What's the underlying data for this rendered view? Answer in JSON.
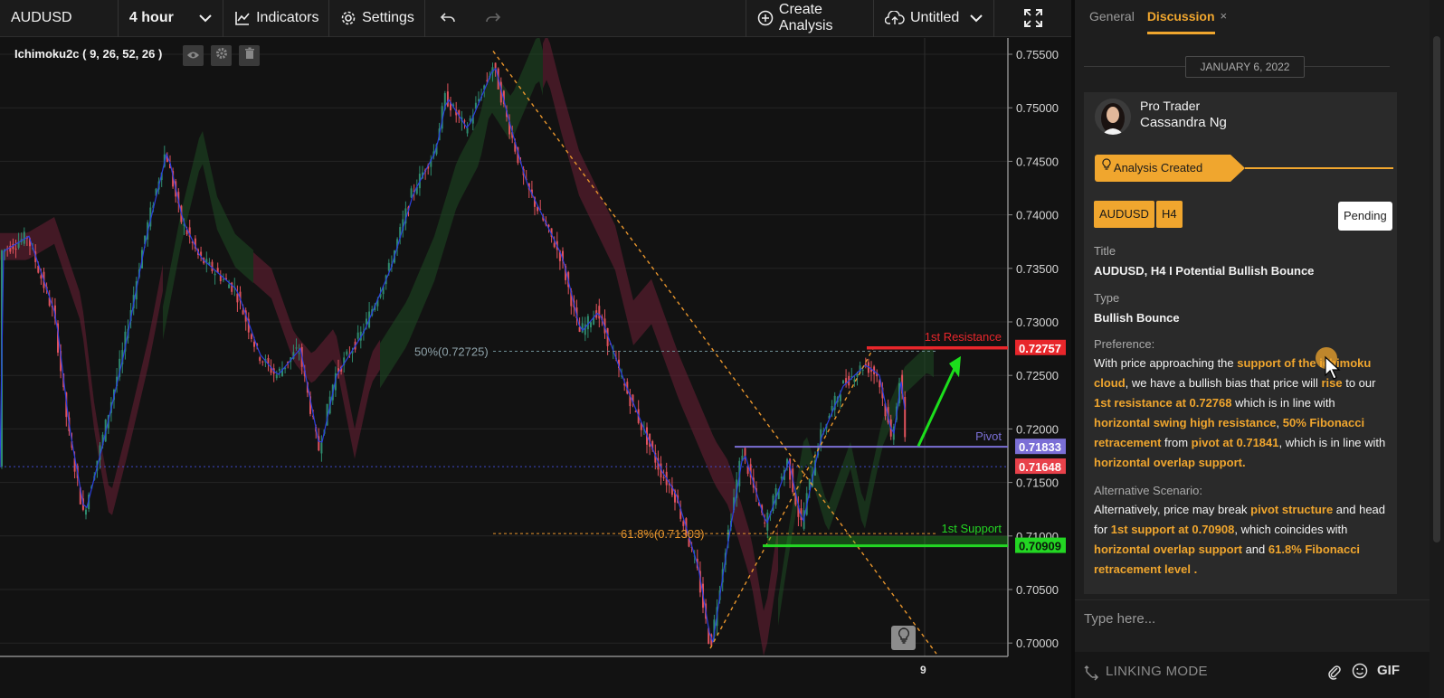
{
  "toolbar": {
    "symbol": "AUDUSD",
    "interval": "4 hour",
    "indicators_label": "Indicators",
    "settings_label": "Settings",
    "create_analysis_label": "Create Analysis",
    "layout_name": "Untitled"
  },
  "chart": {
    "indicator_label": "Ichimoku2c ( 9, 26, 52, 26 )",
    "price_axis_ticks": [
      "0.75500",
      "0.75000",
      "0.74500",
      "0.74000",
      "0.73500",
      "0.73000",
      "0.72500",
      "0.72000",
      "0.71500",
      "0.71000",
      "0.70500",
      "0.70000"
    ],
    "time_axis_label": "9",
    "annotations": {
      "resistance_label": "1st Resistance",
      "pivot_label": "Pivot",
      "support_label": "1st Support",
      "fib50_label": "50%(0.72725)",
      "fib618_label": "61.8%(0.71303)"
    },
    "price_tags": {
      "resistance": "0.72757",
      "pivot": "0.71833",
      "last_price": "0.71648",
      "support": "0.70909"
    },
    "colors": {
      "resistance": "#e8262b",
      "pivot": "#7b6fd6",
      "support": "#23d623",
      "fib": "#e8952c",
      "up_candle": "#2e8b6e",
      "down_candle": "#e0525c"
    }
  },
  "panel": {
    "tabs": [
      {
        "label": "General",
        "active": false
      },
      {
        "label": "Discussion",
        "active": true
      }
    ],
    "close_glyph": "×",
    "date": "JANUARY 6, 2022",
    "author_role": "Pro Trader",
    "author_name": "Cassandra Ng",
    "status": "Analysis Created",
    "tags": [
      "AUDUSD",
      "H4"
    ],
    "pending_label": "Pending",
    "title_label": "Title",
    "title_value": "AUDUSD, H4 I Potential Bullish Bounce",
    "type_label": "Type",
    "type_value": "Bullish Bounce",
    "preference_label": "Preference:",
    "preference_segments": [
      {
        "t": "With price approaching the ",
        "h": false
      },
      {
        "t": "support of the ichimoku cloud",
        "h": true
      },
      {
        "t": ", we have a bullish bias that price will ",
        "h": false
      },
      {
        "t": "rise",
        "h": true
      },
      {
        "t": " to our ",
        "h": false
      },
      {
        "t": "1st resistance at 0.72768",
        "h": true
      },
      {
        "t": " which is in line with ",
        "h": false
      },
      {
        "t": "horizontal swing high resistance",
        "h": true
      },
      {
        "t": ", ",
        "h": false
      },
      {
        "t": "50% Fibonacci retracement",
        "h": true
      },
      {
        "t": " from ",
        "h": false
      },
      {
        "t": "pivot at 0.71841",
        "h": true
      },
      {
        "t": ", which is in line with ",
        "h": false
      },
      {
        "t": "horizontal overlap support.",
        "h": true
      }
    ],
    "alternative_label": "Alternative Scenario:",
    "alternative_segments": [
      {
        "t": "Alternatively, price may break ",
        "h": false
      },
      {
        "t": "pivot structure",
        "h": true
      },
      {
        "t": " and head for ",
        "h": false
      },
      {
        "t": "1st support at 0.70908",
        "h": true
      },
      {
        "t": ", which coincides with ",
        "h": false
      },
      {
        "t": "horizontal overlap support",
        "h": true
      },
      {
        "t": " and ",
        "h": false
      },
      {
        "t": "61.8% Fibonacci retracement level .",
        "h": true
      }
    ],
    "input_placeholder": "Type here...",
    "linking_mode_label": "LINKING MODE",
    "gif_label": "GIF"
  }
}
